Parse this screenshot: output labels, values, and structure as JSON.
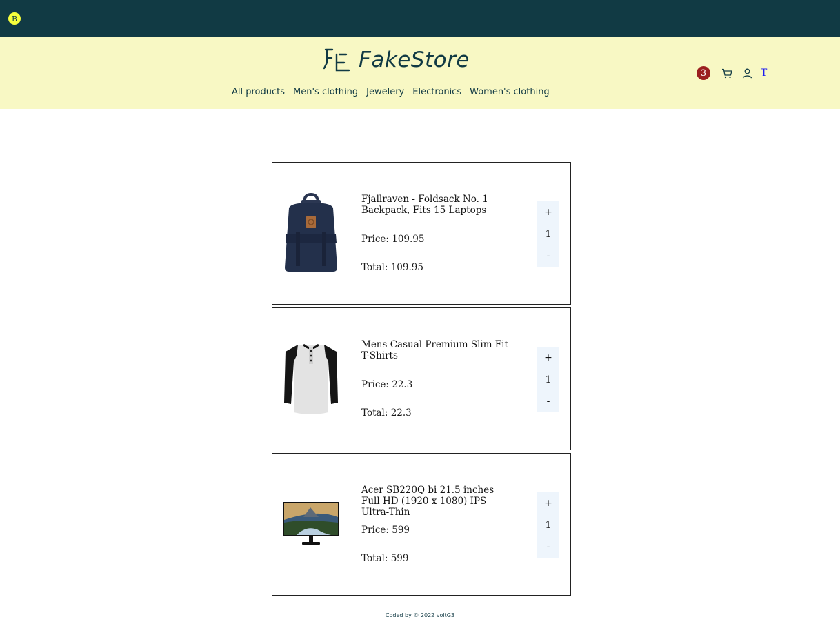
{
  "topbar": {
    "badge": "B"
  },
  "logo": {
    "text": "FakeStore"
  },
  "nav": {
    "items": [
      "All products",
      "Men's clothing",
      "Jewelery",
      "Electronics",
      "Women's clothing"
    ]
  },
  "header_actions": {
    "cart_count": "3",
    "theme_toggle": "T",
    "icons": [
      "cart-icon",
      "user-icon"
    ]
  },
  "cart": {
    "items": [
      {
        "title": "Fjallraven - Foldsack No. 1 Backpack, Fits 15 Laptops",
        "price_label": "Price: 109.95",
        "total_label": "Total: 109.95",
        "plus": "+",
        "qty": "1",
        "minus": "-"
      },
      {
        "title": "Mens Casual Premium Slim Fit T-Shirts",
        "price_label": "Price: 22.3",
        "total_label": "Total: 22.3",
        "plus": "+",
        "qty": "1",
        "minus": "-"
      },
      {
        "title": "Acer SB220Q bi 21.5 inches Full HD (1920 x 1080) IPS Ultra-Thin",
        "price_label": "Price: 599",
        "total_label": "Total: 599",
        "plus": "+",
        "qty": "1",
        "minus": "-"
      }
    ]
  },
  "footer": {
    "text": "Coded by  © 2022 voltG3"
  },
  "colors": {
    "topbar": "#113a44",
    "header": "#f8f8c4",
    "badge": "#f7ff3c",
    "cart_count": "#9b1f1f",
    "stepper": "#eef5fc",
    "theme_toggle": "#1d1df2"
  }
}
